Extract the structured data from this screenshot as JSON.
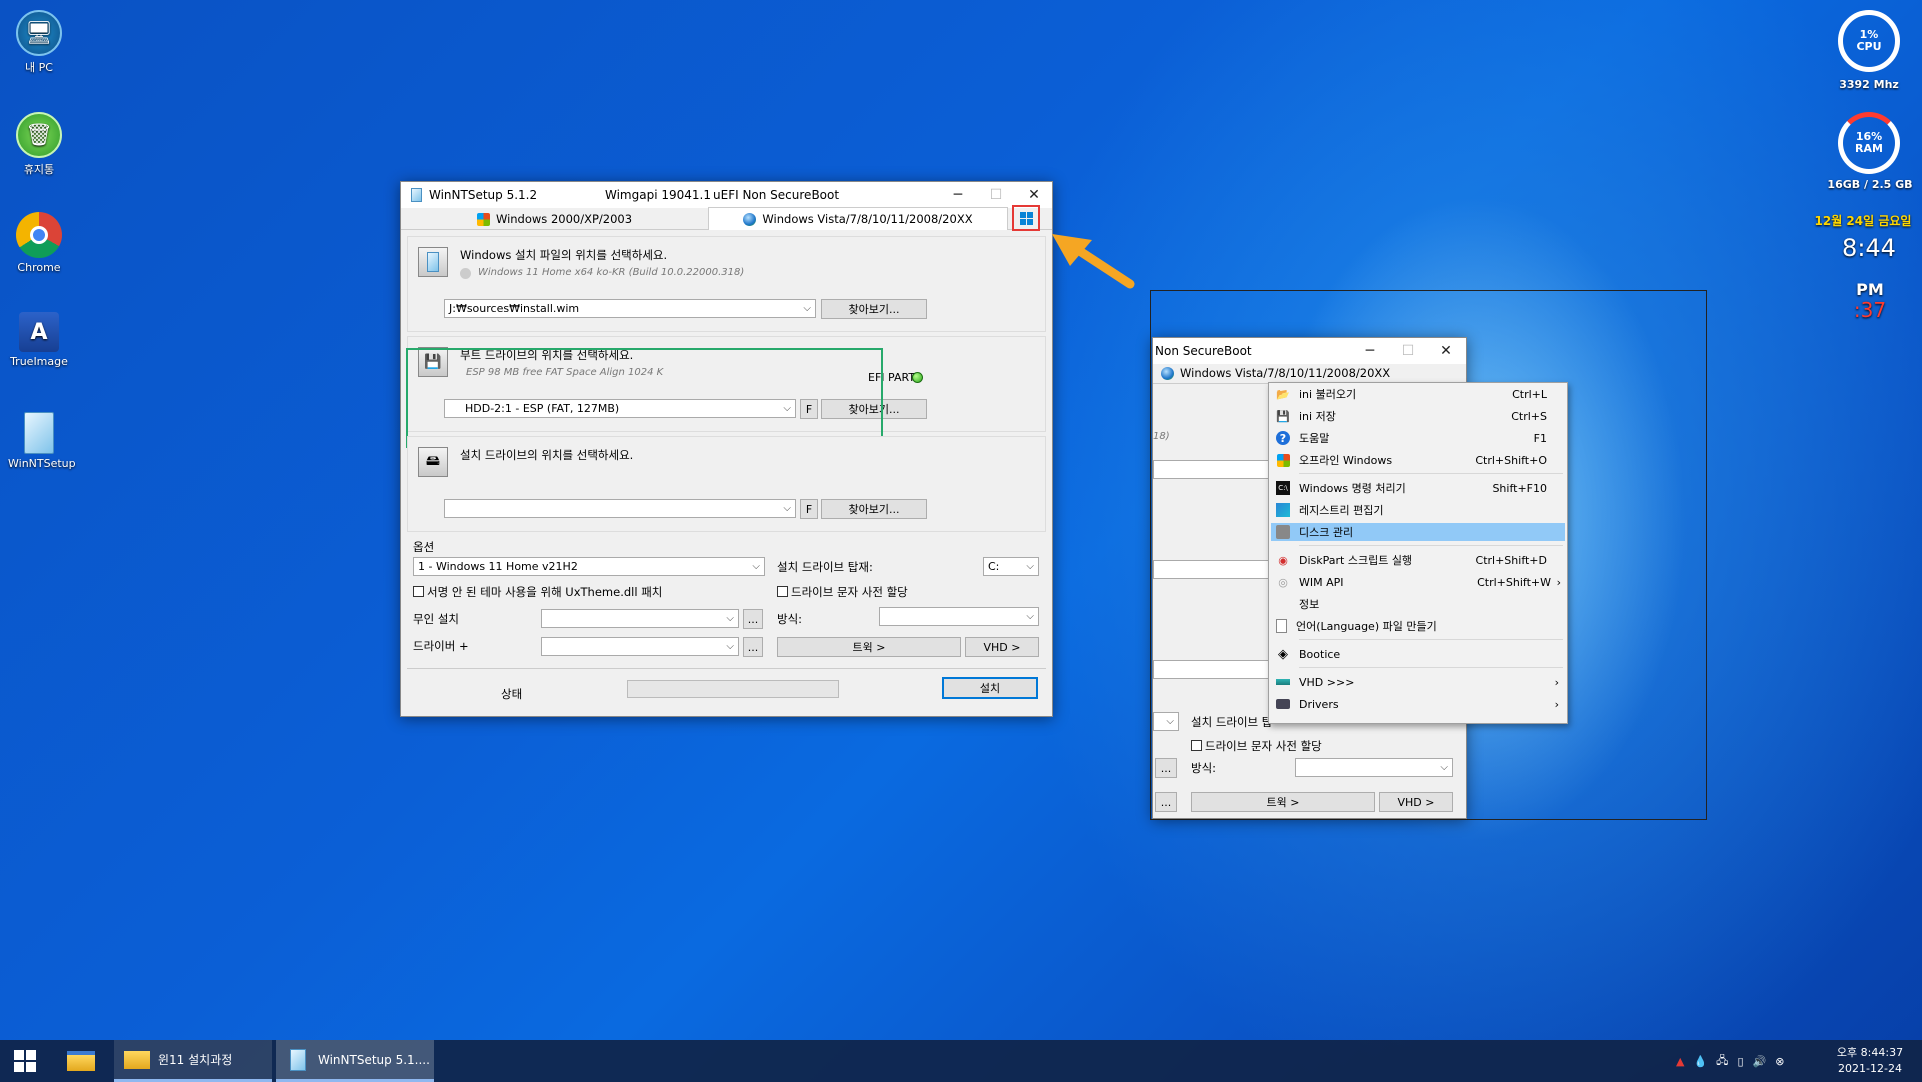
{
  "desktop": {
    "icons": [
      {
        "label": "내 PC",
        "icon": "computer-icon"
      },
      {
        "label": "휴지통",
        "icon": "recycle-bin-icon"
      },
      {
        "label": "Chrome",
        "icon": "chrome-icon"
      },
      {
        "label": "TrueImage",
        "icon": "trueimage-icon"
      },
      {
        "label": "WinNTSetup",
        "icon": "winntsetup-icon"
      }
    ]
  },
  "widgets": {
    "cpu": {
      "percent": "1%",
      "label": "CPU",
      "freq": "3392 Mhz",
      "fill": 0.01
    },
    "ram": {
      "percent": "16%",
      "label": "RAM",
      "usage": "16GB / 2.5 GB",
      "fill": 0.16
    },
    "date": "12월 24일 금요일",
    "time": "8:44",
    "ampm": "PM",
    "seconds": ":37",
    "accent_date": "#ffd700",
    "accent_seconds": "#ff3b30"
  },
  "main_window": {
    "title": "WinNTSetup 5.1.2",
    "wimgapi": "Wimgapi 19041.1",
    "boot_mode": "uEFI Non SecureBoot",
    "tab_legacy": "Windows 2000/XP/2003",
    "tab_modern": "Windows Vista/7/8/10/11/2008/20XX",
    "section1": {
      "title": "Windows 설치 파일의 위치를 선택하세요.",
      "subtitle": "Windows 11 Home  x64 ko-KR (Build 10.0.22000.318)",
      "path": "J:₩sources₩install.wim",
      "browse": "찾아보기..."
    },
    "section2": {
      "title": "부트 드라이브의 위치를 선택하세요.",
      "subtitle": "ESP 98 MB free FAT Space Align 1024 K",
      "efi_label": "EFI PART",
      "drive": "HDD-2:1 -  ESP (FAT, 127MB)",
      "f_button": "F",
      "browse": "찾아보기..."
    },
    "section3": {
      "title": "설치 드라이브의 위치를 선택하세요.",
      "drive": "",
      "f_button": "F",
      "browse": "찾아보기..."
    },
    "options": {
      "label": "옵션",
      "edition": "1 - Windows 11 Home v21H2",
      "mount_label": "설치 드라이브 탑재:",
      "mount_value": "C:",
      "uxtheme": "서명 안 된 테마 사용을 위해 UxTheme.dll 패치",
      "prealloc": "드라이브 문자 사전 할당",
      "unattend": "무인 설치",
      "method": "방식:",
      "driver": "드라이버 +",
      "dots": "...",
      "tweaks": "트윅 >",
      "vhd": "VHD >"
    },
    "status_label": "상태",
    "install": "설치"
  },
  "second_window": {
    "title": "Non SecureBoot",
    "tab_modern": "Windows Vista/7/8/10/11/2008/20XX",
    "partial_text": "18)",
    "mount_label": "설치 드라이브 탑",
    "prealloc": "드라이브 문자 사전 할당",
    "method": "방식:",
    "dots": "...",
    "tweaks": "트윅 >",
    "vhd": "VHD >"
  },
  "context_menu": {
    "items": [
      {
        "label": "ini 불러오기",
        "shortcut": "Ctrl+L",
        "icon": "folder-open-icon"
      },
      {
        "label": "ini 저장",
        "shortcut": "Ctrl+S",
        "icon": "save-icon"
      },
      {
        "label": "도움말",
        "shortcut": "F1",
        "icon": "help-icon"
      },
      {
        "label": "오프라인 Windows",
        "shortcut": "Ctrl+Shift+O",
        "icon": "windows-flag-icon"
      },
      {
        "label": "Windows 명령 처리기",
        "shortcut": "Shift+F10",
        "icon": "cmd-icon"
      },
      {
        "label": "레지스트리 편집기",
        "shortcut": "",
        "icon": "registry-icon"
      },
      {
        "label": "디스크 관리",
        "shortcut": "",
        "icon": "disk-management-icon"
      },
      {
        "label": "DiskPart 스크립트 실행",
        "shortcut": "Ctrl+Shift+D",
        "icon": "diskpart-icon"
      },
      {
        "label": "WIM API",
        "shortcut": "Ctrl+Shift+W",
        "icon": "wim-icon"
      },
      {
        "label": "정보",
        "shortcut": "",
        "icon": ""
      },
      {
        "label": "언어(Language) 파일 만들기",
        "shortcut": "",
        "icon": "file-icon"
      },
      {
        "label": "Bootice",
        "shortcut": "",
        "icon": "bootice-icon"
      },
      {
        "label": "VHD >>>",
        "shortcut": "",
        "icon": "vhd-icon"
      },
      {
        "label": "Drivers",
        "shortcut": "",
        "icon": "drivers-icon"
      }
    ],
    "highlight_color": "#91c9f7"
  },
  "taskbar": {
    "items": [
      {
        "label": "윈11 설치과정"
      },
      {
        "label": "WinNTSetup 5.1...."
      }
    ],
    "clock_time": "오후 8:44:37",
    "clock_date": "2021-12-24"
  },
  "highlights": {
    "green_box": "#27a96b",
    "red_box": "#e53935",
    "arrow": "#f5a623"
  }
}
